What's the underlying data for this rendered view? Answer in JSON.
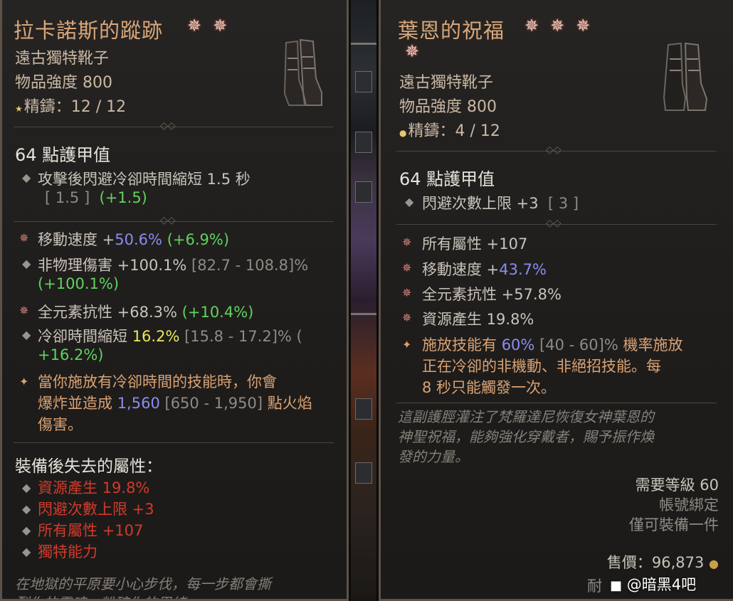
{
  "left": {
    "title": "拉卡諾斯的蹤跡",
    "stars": [
      "✵",
      "✵"
    ],
    "subtitle": "遠古獨特靴子",
    "power": "物品強度 800",
    "temper": "精鑄：12 / 12",
    "armor": "64 點護甲值",
    "implicit": {
      "text": "攻擊後閃避冷卻時間縮短 1.5 秒",
      "range": "[ 1.5 ]",
      "delta": "(+1.5)"
    },
    "affixes": [
      {
        "label": "移動速度 +",
        "value": "50.6%",
        "delta": "(+6.9%)"
      },
      {
        "label": "非物理傷害 +100.1%",
        "range": "[82.7 - 108.8]%",
        "delta": "(+100.1%)"
      },
      {
        "label": "全元素抗性 +68.3%",
        "delta": "(+10.4%)"
      },
      {
        "label": "冷卻時間縮短",
        "value": "16.2%",
        "range": "[15.8 - 17.2]% (",
        "delta": "+16.2%)"
      }
    ],
    "aspect": {
      "line1": "當你施放有冷卻時間的技能時，你會",
      "line2_pre": "爆炸並造成",
      "line2_value": "1,560",
      "line2_range": "[650 - 1,950]",
      "line2_post": "點火焰",
      "line3": "傷害。"
    },
    "lost_header": "裝備後失去的屬性：",
    "lost": [
      "資源產生 19.8%",
      "閃避次數上限 +3",
      "所有屬性 +107",
      "獨特能力"
    ],
    "flavor": [
      "在地獄的平原要小心步伐，每一步都會撕",
      "裂你的靈魂，粉碎你的思緒。"
    ]
  },
  "right": {
    "title": "葉恩的祝福",
    "stars": [
      "✵",
      "✵",
      "✵",
      "✵"
    ],
    "subtitle": "遠古獨特靴子",
    "power": "物品強度 800",
    "temper": "精鑄：4 / 12",
    "armor": "64 點護甲值",
    "implicit": {
      "text": "閃避次數上限 +3",
      "range": "[ 3 ]"
    },
    "affixes": [
      {
        "label": "所有屬性 +107"
      },
      {
        "label": "移動速度 +",
        "value": "43.7%"
      },
      {
        "label": "全元素抗性 +57.8%"
      },
      {
        "label": "資源產生 19.8%"
      }
    ],
    "aspect": {
      "line1_pre": "施放技能有",
      "line1_value": "60%",
      "line1_range": "[40 - 60]%",
      "line1_post": "機率施放",
      "line2": "正在冷卻的非機動、非絕招技能。每",
      "line3": "8 秒只能觸發一次。"
    },
    "flavor": [
      "這副護脛灌注了梵羅達尼恢復女神葉恩的",
      "神聖祝福，能夠強化穿戴者，賜予振作煥",
      "發的力量。"
    ],
    "required_level": "需要等級 60",
    "account_bound": "帳號綁定",
    "unique_equip": "僅可裝備一件",
    "sell_price": "售價：96,873",
    "durability_partial": "耐",
    "watermark": "@暗黑4吧"
  },
  "colors": {
    "unique_title": "#d9a77a",
    "greater_affix": "#8a8cf0",
    "improvement": "#5fd35f",
    "lost_stat": "#d23a2c",
    "aspect_text": "#d9a274"
  }
}
